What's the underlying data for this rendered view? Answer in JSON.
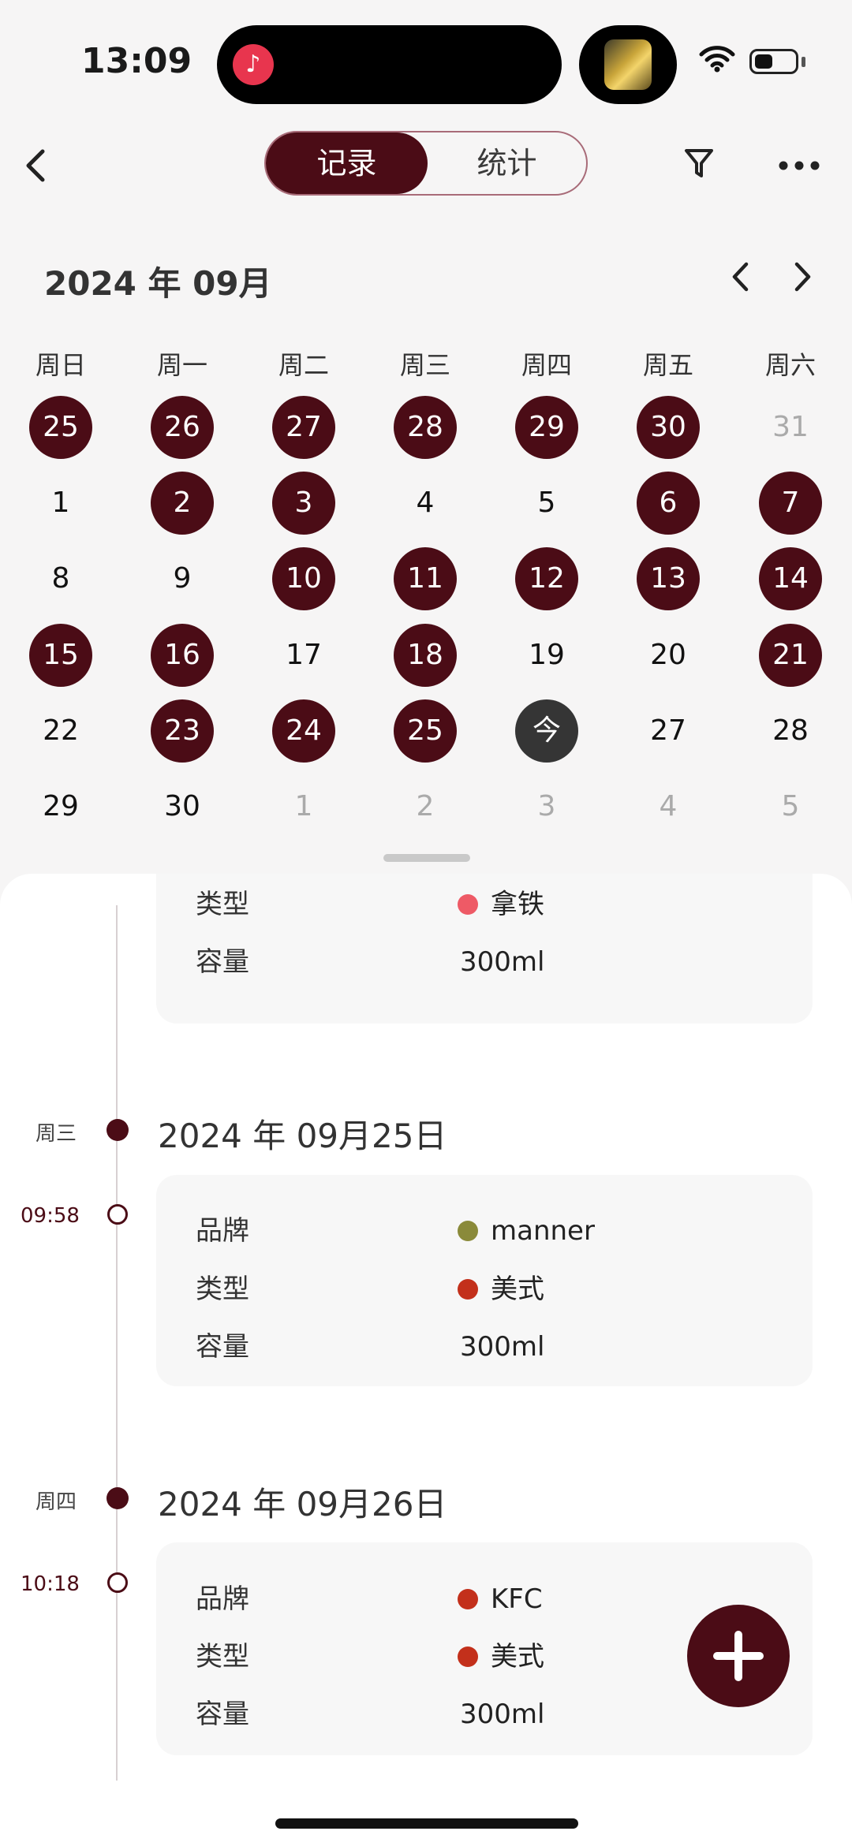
{
  "status_bar": {
    "time": "13:09"
  },
  "nav": {
    "tabs": [
      {
        "label": "记录",
        "active": true
      },
      {
        "label": "统计",
        "active": false
      }
    ]
  },
  "calendar": {
    "month_title": "2024 年 09月",
    "weekdays": [
      "周日",
      "周一",
      "周二",
      "周三",
      "周四",
      "周五",
      "周六"
    ],
    "weeks": [
      [
        {
          "label": "25",
          "state": "logged"
        },
        {
          "label": "26",
          "state": "logged"
        },
        {
          "label": "27",
          "state": "logged"
        },
        {
          "label": "28",
          "state": "logged"
        },
        {
          "label": "29",
          "state": "logged"
        },
        {
          "label": "30",
          "state": "logged"
        },
        {
          "label": "31",
          "state": "muted"
        }
      ],
      [
        {
          "label": "1",
          "state": "normal"
        },
        {
          "label": "2",
          "state": "logged"
        },
        {
          "label": "3",
          "state": "logged"
        },
        {
          "label": "4",
          "state": "normal"
        },
        {
          "label": "5",
          "state": "normal"
        },
        {
          "label": "6",
          "state": "logged"
        },
        {
          "label": "7",
          "state": "logged"
        }
      ],
      [
        {
          "label": "8",
          "state": "normal"
        },
        {
          "label": "9",
          "state": "normal"
        },
        {
          "label": "10",
          "state": "logged"
        },
        {
          "label": "11",
          "state": "logged"
        },
        {
          "label": "12",
          "state": "logged"
        },
        {
          "label": "13",
          "state": "logged"
        },
        {
          "label": "14",
          "state": "logged"
        }
      ],
      [
        {
          "label": "15",
          "state": "logged"
        },
        {
          "label": "16",
          "state": "logged"
        },
        {
          "label": "17",
          "state": "normal"
        },
        {
          "label": "18",
          "state": "logged"
        },
        {
          "label": "19",
          "state": "normal"
        },
        {
          "label": "20",
          "state": "normal"
        },
        {
          "label": "21",
          "state": "logged"
        }
      ],
      [
        {
          "label": "22",
          "state": "normal"
        },
        {
          "label": "23",
          "state": "logged"
        },
        {
          "label": "24",
          "state": "logged"
        },
        {
          "label": "25",
          "state": "logged"
        },
        {
          "label": "今",
          "state": "today"
        },
        {
          "label": "27",
          "state": "normal"
        },
        {
          "label": "28",
          "state": "normal"
        }
      ],
      [
        {
          "label": "29",
          "state": "normal"
        },
        {
          "label": "30",
          "state": "normal"
        },
        {
          "label": "1",
          "state": "muted"
        },
        {
          "label": "2",
          "state": "muted"
        },
        {
          "label": "3",
          "state": "muted"
        },
        {
          "label": "4",
          "state": "muted"
        },
        {
          "label": "5",
          "state": "muted"
        }
      ]
    ]
  },
  "timeline": {
    "partial_card": {
      "rows": [
        {
          "key": "类型",
          "value": "拿铁",
          "dot_color": "#ee5a66"
        },
        {
          "key": "容量",
          "value": "300ml"
        }
      ]
    },
    "days": [
      {
        "weekday": "周三",
        "date": "2024 年 09月25日",
        "entries": [
          {
            "time": "09:58",
            "rows": [
              {
                "key": "品牌",
                "value": "manner",
                "dot_color": "#8a8a3a"
              },
              {
                "key": "类型",
                "value": "美式",
                "dot_color": "#c3301b"
              },
              {
                "key": "容量",
                "value": "300ml"
              }
            ]
          }
        ]
      },
      {
        "weekday": "周四",
        "date": "2024 年 09月26日",
        "entries": [
          {
            "time": "10:18",
            "rows": [
              {
                "key": "品牌",
                "value": "KFC",
                "dot_color": "#c3301b"
              },
              {
                "key": "类型",
                "value": "美式",
                "dot_color": "#c3301b"
              },
              {
                "key": "容量",
                "value": "300ml"
              }
            ]
          }
        ]
      }
    ]
  },
  "colors": {
    "accent": "#4b0c16",
    "today": "#353535"
  },
  "icons": [
    "back-icon",
    "filter-icon",
    "more-icon",
    "chevron-left-icon",
    "chevron-right-icon",
    "add-icon",
    "wifi-icon",
    "battery-icon",
    "music-app-icon"
  ]
}
